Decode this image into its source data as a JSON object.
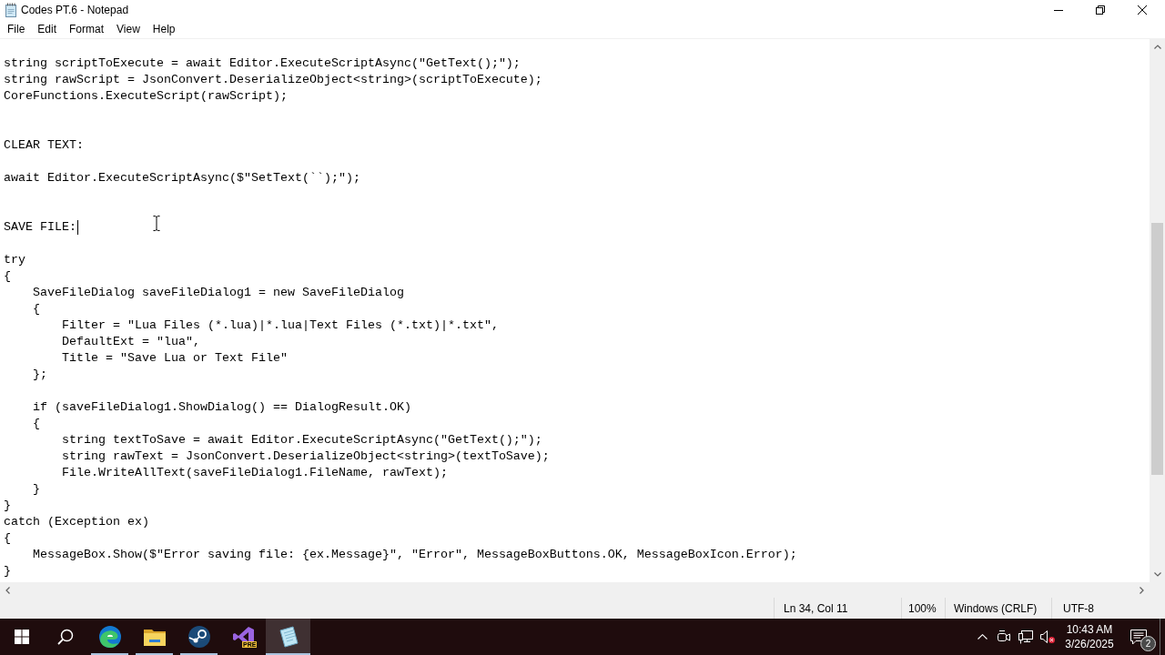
{
  "window": {
    "title": "Codes PT.6 - Notepad"
  },
  "menu": [
    "File",
    "Edit",
    "Format",
    "View",
    "Help"
  ],
  "editor": {
    "lines": [
      {
        "kind": "blank"
      },
      {
        "kind": "code",
        "text": "string scriptToExecute = await Editor.ExecuteScriptAsync(\"GetText();\");",
        "caret": false
      },
      {
        "kind": "code",
        "text": "string rawScript = JsonConvert.DeserializeObject<string>(scriptToExecute);",
        "caret": false
      },
      {
        "kind": "code",
        "text": "CoreFunctions.ExecuteScript(rawScript);",
        "caret": false
      },
      {
        "kind": "blank"
      },
      {
        "kind": "blank"
      },
      {
        "kind": "code",
        "text": "CLEAR TEXT:",
        "caret": false
      },
      {
        "kind": "blank"
      },
      {
        "kind": "code",
        "text": "await Editor.ExecuteScriptAsync($\"SetText(``);\");",
        "caret": false
      },
      {
        "kind": "blank"
      },
      {
        "kind": "blank"
      },
      {
        "kind": "code",
        "text": "SAVE FILE:",
        "caret": true
      },
      {
        "kind": "blank"
      },
      {
        "kind": "code",
        "text": "try",
        "caret": false
      },
      {
        "kind": "code",
        "text": "{",
        "caret": false
      },
      {
        "kind": "code",
        "text": "    SaveFileDialog saveFileDialog1 = new SaveFileDialog",
        "caret": false
      },
      {
        "kind": "code",
        "text": "    {",
        "caret": false
      },
      {
        "kind": "code",
        "text": "        Filter = \"Lua Files (*.lua)|*.lua|Text Files (*.txt)|*.txt\",",
        "caret": false
      },
      {
        "kind": "code",
        "text": "        DefaultExt = \"lua\",",
        "caret": false
      },
      {
        "kind": "code",
        "text": "        Title = \"Save Lua or Text File\"",
        "caret": false
      },
      {
        "kind": "code",
        "text": "    };",
        "caret": false
      },
      {
        "kind": "blank"
      },
      {
        "kind": "code",
        "text": "    if (saveFileDialog1.ShowDialog() == DialogResult.OK)",
        "caret": false
      },
      {
        "kind": "code",
        "text": "    {",
        "caret": false
      },
      {
        "kind": "code",
        "text": "        string textToSave = await Editor.ExecuteScriptAsync(\"GetText();\");",
        "caret": false
      },
      {
        "kind": "code",
        "text": "        string rawText = JsonConvert.DeserializeObject<string>(textToSave);",
        "caret": false
      },
      {
        "kind": "code",
        "text": "        File.WriteAllText(saveFileDialog1.FileName, rawText);",
        "caret": false
      },
      {
        "kind": "code",
        "text": "    }",
        "caret": false
      },
      {
        "kind": "code",
        "text": "}",
        "caret": false
      },
      {
        "kind": "code",
        "text": "catch (Exception ex)",
        "caret": false
      },
      {
        "kind": "code",
        "text": "{",
        "caret": false
      },
      {
        "kind": "code",
        "text": "    MessageBox.Show($\"Error saving file: {ex.Message}\", \"Error\", MessageBoxButtons.OK, MessageBoxIcon.Error);",
        "caret": false
      },
      {
        "kind": "code",
        "text": "}",
        "caret": false
      }
    ]
  },
  "status_bar": {
    "position": "Ln 34, Col 11",
    "zoom": "100%",
    "line_endings": "Windows (CRLF)",
    "encoding": "UTF-8"
  },
  "taskbar": {
    "buttons": [
      {
        "kind": "start"
      },
      {
        "kind": "search"
      }
    ],
    "apps": [
      {
        "kind": "browser",
        "running": true,
        "selected": false
      },
      {
        "kind": "files",
        "running": true,
        "selected": false
      },
      {
        "kind": "games",
        "running": true,
        "selected": false
      },
      {
        "kind": "ide",
        "badge": "PRE",
        "running": false,
        "selected": false
      },
      {
        "kind": "notepad",
        "running": true,
        "selected": true
      }
    ],
    "tray": {
      "volume": {
        "muted": true
      },
      "time": "10:43 AM",
      "date": "3/26/2025",
      "notifications": "2"
    }
  }
}
